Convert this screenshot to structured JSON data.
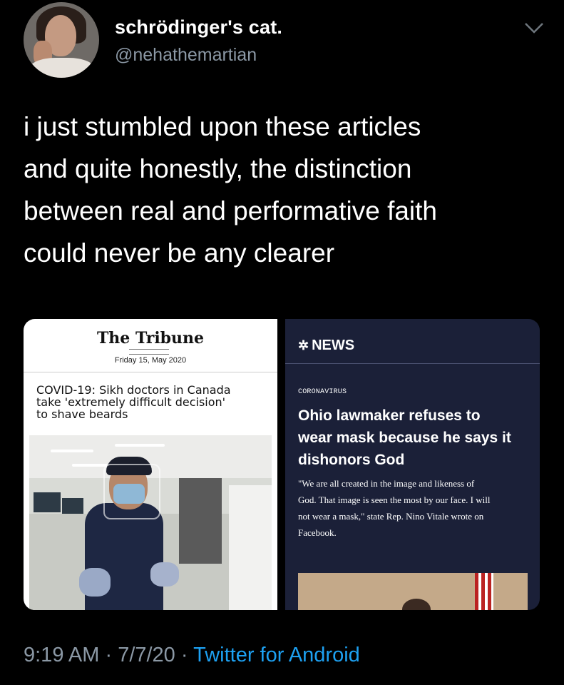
{
  "header": {
    "display_name": "schrödinger's cat.",
    "handle": "@nehathemartian"
  },
  "tweet": {
    "lines": [
      "i just stumbled upon these articles",
      "and quite honestly, the distinction",
      "between real and performative faith",
      "could never be any clearer"
    ]
  },
  "media": {
    "left_card": {
      "masthead": "The Tribune",
      "date": "Friday 15, May 2020",
      "headline_lines": [
        "COVID-19: Sikh doctors in Canada",
        "take 'extremely difficult decision'",
        "to shave beards"
      ]
    },
    "right_card": {
      "logo": "NEWS",
      "section": "CORONAVIRUS",
      "headline_lines": [
        "Ohio lawmaker refuses to",
        "wear mask because he says it",
        "dishonors God"
      ],
      "body_lines": [
        "\"We are all created in the image and likeness of",
        "God. That image is seen the most by our face. I will",
        "not wear a mask,\" state Rep. Nino Vitale wrote on",
        "Facebook."
      ]
    }
  },
  "footer": {
    "time": "9:19 AM",
    "sep1": " · ",
    "date": "7/7/20",
    "sep2": " · ",
    "source": "Twitter for Android"
  },
  "colors": {
    "background": "#000000",
    "handle_gray": "#8b98a5",
    "link_blue": "#1da1f2",
    "nbc_navy": "#1b2038"
  }
}
